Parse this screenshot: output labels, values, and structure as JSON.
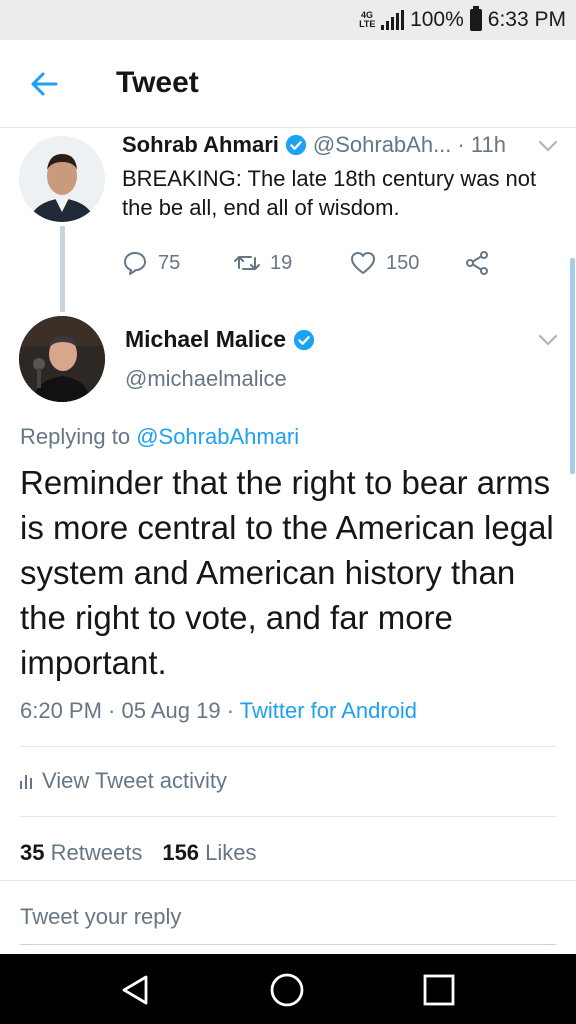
{
  "status_bar": {
    "network": "4G\nLTE",
    "battery": "100%",
    "time": "6:33 PM"
  },
  "header": {
    "title": "Tweet"
  },
  "quoted_tweet": {
    "name": "Sohrab Ahmari",
    "handle": "@SohrabAh...",
    "time": "· 11h",
    "text": "BREAKING: The late 18th century was not the be all, end all of wisdom.",
    "replies": "75",
    "retweets": "19",
    "likes": "150"
  },
  "tweet": {
    "name": "Michael Malice",
    "handle": "@michaelmalice",
    "replying_prefix": "Replying to ",
    "replying_to": "@SohrabAhmari",
    "text": "Reminder that the right to bear arms is more central to the American legal system and American history than the right to vote, and far more important.",
    "timestamp": "6:20 PM · 05 Aug 19 · ",
    "source": "Twitter for Android",
    "activity_label": "View Tweet activity",
    "retweets_count": "35",
    "retweets_label": "Retweets",
    "likes_count": "156",
    "likes_label": "Likes"
  },
  "reply_placeholder": "Tweet your reply",
  "colors": {
    "accent": "#1da1f2",
    "secondary_text": "#657786",
    "primary_text": "#14171a"
  },
  "icons": {
    "back": "arrow-left-icon",
    "verified": "verified-badge-icon",
    "reply": "reply-icon",
    "retweet": "retweet-icon",
    "like": "heart-icon",
    "share": "share-icon",
    "activity": "bar-chart-icon",
    "nav_back": "triangle-back-icon",
    "nav_home": "circle-home-icon",
    "nav_recents": "square-recents-icon"
  }
}
